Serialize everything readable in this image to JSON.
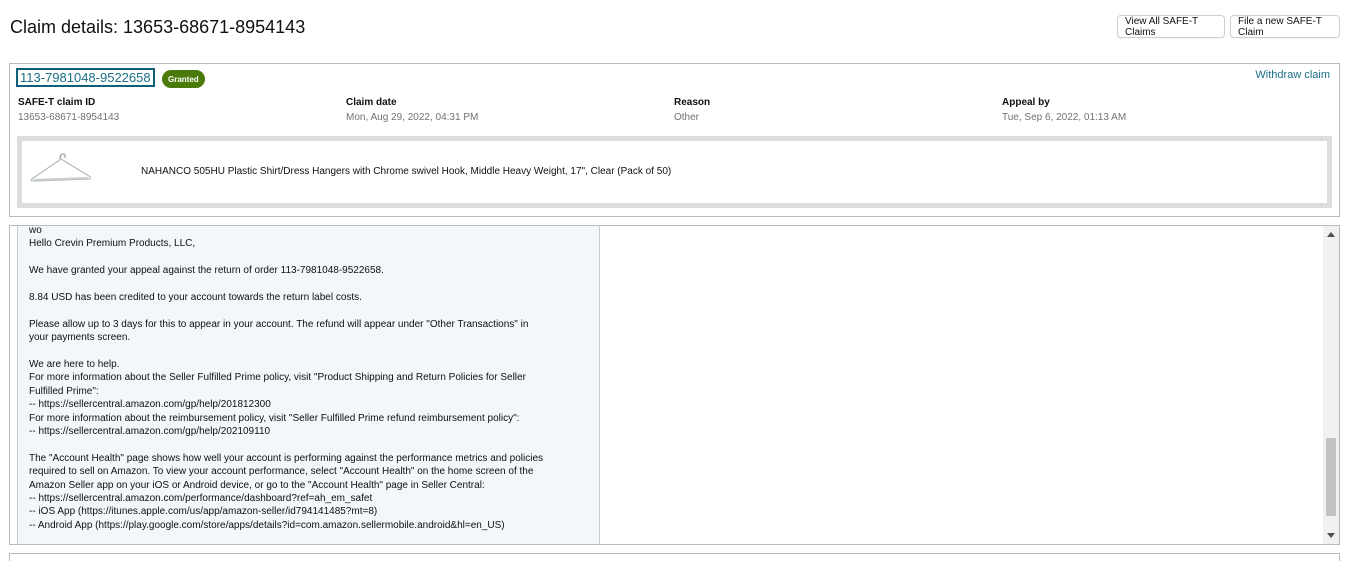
{
  "header": {
    "title": "Claim details: 13653-68671-8954143",
    "view_all_label": "View All SAFE-T Claims",
    "file_new_label": "File a new SAFE-T Claim"
  },
  "claim": {
    "order_id": "113-7981048-9522658",
    "status": "Granted",
    "status_color": "#4a7b0a",
    "withdraw_label": "Withdraw claim",
    "details": [
      {
        "label": "SAFE-T claim ID",
        "value": "13653-68671-8954143"
      },
      {
        "label": "Claim date",
        "value": "Mon, Aug 29, 2022, 04:31 PM"
      },
      {
        "label": "Reason",
        "value": "Other"
      },
      {
        "label": "Appeal by",
        "value": "Tue, Sep 6, 2022, 01:13 AM"
      }
    ],
    "product": {
      "title": "NAHANCO 505HU Plastic Shirt/Dress Hangers with Chrome swivel Hook, Middle Heavy Weight, 17\", Clear (Pack of 50)",
      "image_icon": "hanger-icon"
    }
  },
  "message": {
    "lines": [
      "wo",
      "Hello Crevin Premium Products, LLC,",
      "",
      "We have granted your appeal against the return of order 113-7981048-9522658.",
      "",
      "8.84 USD has been credited to your account towards the return label costs.",
      "",
      "Please allow up to 3 days for this to appear in your account. The refund will appear under \"Other Transactions\" in",
      "your payments screen.",
      "",
      "We are here to help.",
      "For more information about the Seller Fulfilled Prime policy, visit \"Product Shipping and Return Policies for Seller",
      "Fulfilled Prime\":",
      "-- https://sellercentral.amazon.com/gp/help/201812300",
      "For more information about the reimbursement policy, visit \"Seller Fulfilled Prime refund reimbursement policy\":",
      "-- https://sellercentral.amazon.com/gp/help/202109110",
      "",
      "The \"Account Health\" page shows how well your account is performing against the performance metrics and policies",
      "required to sell on Amazon. To view your account performance, select \"Account Health\" on the home screen of the",
      "Amazon Seller app on your iOS or Android device, or go to the \"Account Health\" page in Seller Central:",
      "-- https://sellercentral.amazon.com/performance/dashboard?ref=ah_em_safet",
      "-- iOS App (https://itunes.apple.com/us/app/amazon-seller/id794141485?mt=8)",
      "-- Android App (https://play.google.com/store/apps/details?id=com.amazon.sellermobile.android&hl=en_US)"
    ]
  },
  "colors": {
    "link": "#1a6f87",
    "message_bg": "#f1f7fa"
  }
}
